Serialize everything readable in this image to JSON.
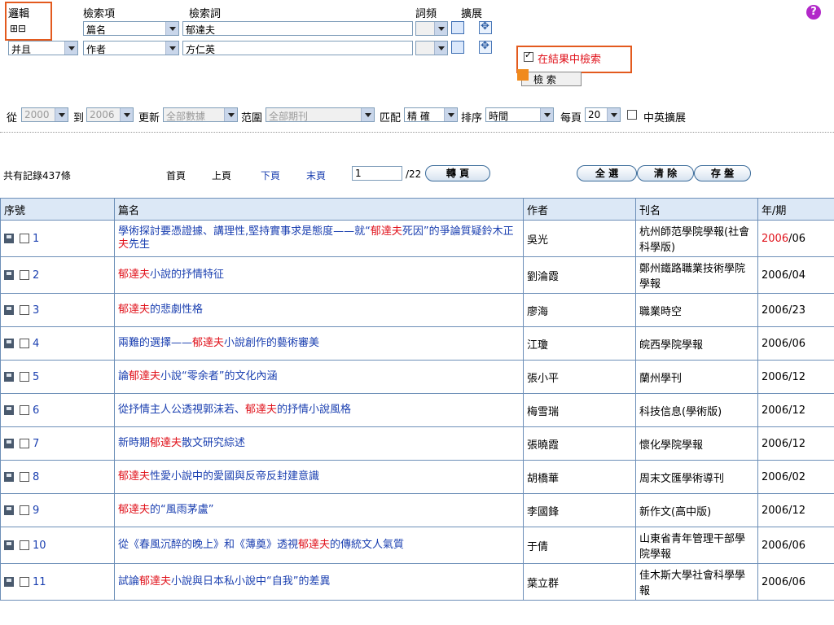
{
  "search": {
    "logic_label": "邏輯",
    "field_label": "檢索項",
    "term_label": "檢索詞",
    "freq_label": "詞頻",
    "expand_label": "擴展",
    "row1": {
      "field": "篇名",
      "term": "郁達夫"
    },
    "row2": {
      "logic": "并且",
      "field": "作者",
      "term": "方仁英"
    },
    "search_within_label": "在結果中檢索",
    "search_button": "檢 索",
    "help_icon": "?"
  },
  "filters": {
    "from_label": "從",
    "from_year": "2000",
    "to_label": "到",
    "to_year": "2006",
    "update_label": "更新",
    "update_value": "全部數據",
    "scope_label": "范圍",
    "scope_value": "全部期刊",
    "match_label": "匹配",
    "match_value": "精 確",
    "sort_label": "排序",
    "sort_value": "時間",
    "per_page_label": "每頁",
    "per_page_value": "20",
    "cn_en_label": "中英擴展"
  },
  "pager": {
    "total_text": "共有記錄437條",
    "first": "首頁",
    "prev": "上頁",
    "next": "下頁",
    "last": "末頁",
    "page_value": "1",
    "page_total": "/22",
    "go_button": "轉 頁",
    "select_all": "全 選",
    "clear": "清 除",
    "save": "存 盤"
  },
  "table": {
    "headers": [
      "序號",
      "篇名",
      "作者",
      "刊名",
      "年/期"
    ],
    "rows": [
      {
        "no": "1",
        "title": [
          [
            "學術探討要憑證據、講理性,堅持實事求是態度——就“",
            false
          ],
          [
            "郁達夫",
            true
          ],
          [
            "死因”的爭論質疑鈴木正",
            false
          ],
          [
            "夫",
            true
          ],
          [
            "先生",
            false
          ]
        ],
        "author": "吳光",
        "journal": "杭州師范學院學報(社會科學版)",
        "year": "2006",
        "issue": "/06",
        "red_year": true
      },
      {
        "no": "2",
        "title": [
          [
            "郁達夫",
            true
          ],
          [
            "小說的抒情特征",
            false
          ]
        ],
        "author": "劉淪霞",
        "journal": "鄭州鐵路職業技術學院學報",
        "year": "2006",
        "issue": "/04",
        "red_year": false
      },
      {
        "no": "3",
        "title": [
          [
            "郁達夫",
            true
          ],
          [
            "的悲劇性格",
            false
          ]
        ],
        "author": "廖海",
        "journal": "職業時空",
        "year": "2006",
        "issue": "/23",
        "red_year": false
      },
      {
        "no": "4",
        "title": [
          [
            "兩難的選擇——",
            false
          ],
          [
            "郁達夫",
            true
          ],
          [
            "小說創作的藝術審美",
            false
          ]
        ],
        "author": "江瓊",
        "journal": "皖西學院學報",
        "year": "2006",
        "issue": "/06",
        "red_year": false
      },
      {
        "no": "5",
        "title": [
          [
            "論",
            false
          ],
          [
            "郁達夫",
            true
          ],
          [
            "小說“零余者”的文化內涵",
            false
          ]
        ],
        "author": "張小平",
        "journal": "蘭州學刊",
        "year": "2006",
        "issue": "/12",
        "red_year": false
      },
      {
        "no": "6",
        "title": [
          [
            "從抒情主人公透視郭沫若、",
            false
          ],
          [
            "郁達夫",
            true
          ],
          [
            "的抒情小說風格",
            false
          ]
        ],
        "author": "梅雪瑞",
        "journal": "科技信息(學術版)",
        "year": "2006",
        "issue": "/12",
        "red_year": false
      },
      {
        "no": "7",
        "title": [
          [
            "新時期",
            false
          ],
          [
            "郁達夫",
            true
          ],
          [
            "散文研究綜述",
            false
          ]
        ],
        "author": "張曉霞",
        "journal": "懷化學院學報",
        "year": "2006",
        "issue": "/12",
        "red_year": false
      },
      {
        "no": "8",
        "title": [
          [
            "郁達夫",
            true
          ],
          [
            "性愛小說中的愛國與反帝反封建意識",
            false
          ]
        ],
        "author": "胡橋華",
        "journal": "周末文匯學術導刊",
        "year": "2006",
        "issue": "/02",
        "red_year": false
      },
      {
        "no": "9",
        "title": [
          [
            "郁達夫",
            true
          ],
          [
            "的“風雨茅盧”",
            false
          ]
        ],
        "author": "李國鋒",
        "journal": "新作文(高中版)",
        "year": "2006",
        "issue": "/12",
        "red_year": false
      },
      {
        "no": "10",
        "title": [
          [
            "從《春風沉醉的晚上》和《薄奠》透視",
            false
          ],
          [
            "郁達夫",
            true
          ],
          [
            "的傳統文人氣質",
            false
          ]
        ],
        "author": "于倩",
        "journal": "山東省青年管理干部學院學報",
        "year": "2006",
        "issue": "/06",
        "red_year": false
      },
      {
        "no": "11",
        "title": [
          [
            "試論",
            false
          ],
          [
            "郁達夫",
            true
          ],
          [
            "小說與日本私小說中“自我”的差異",
            false
          ]
        ],
        "author": "葉立群",
        "journal": "佳木斯大學社會科學學報",
        "year": "2006",
        "issue": "/06",
        "red_year": false
      }
    ]
  }
}
